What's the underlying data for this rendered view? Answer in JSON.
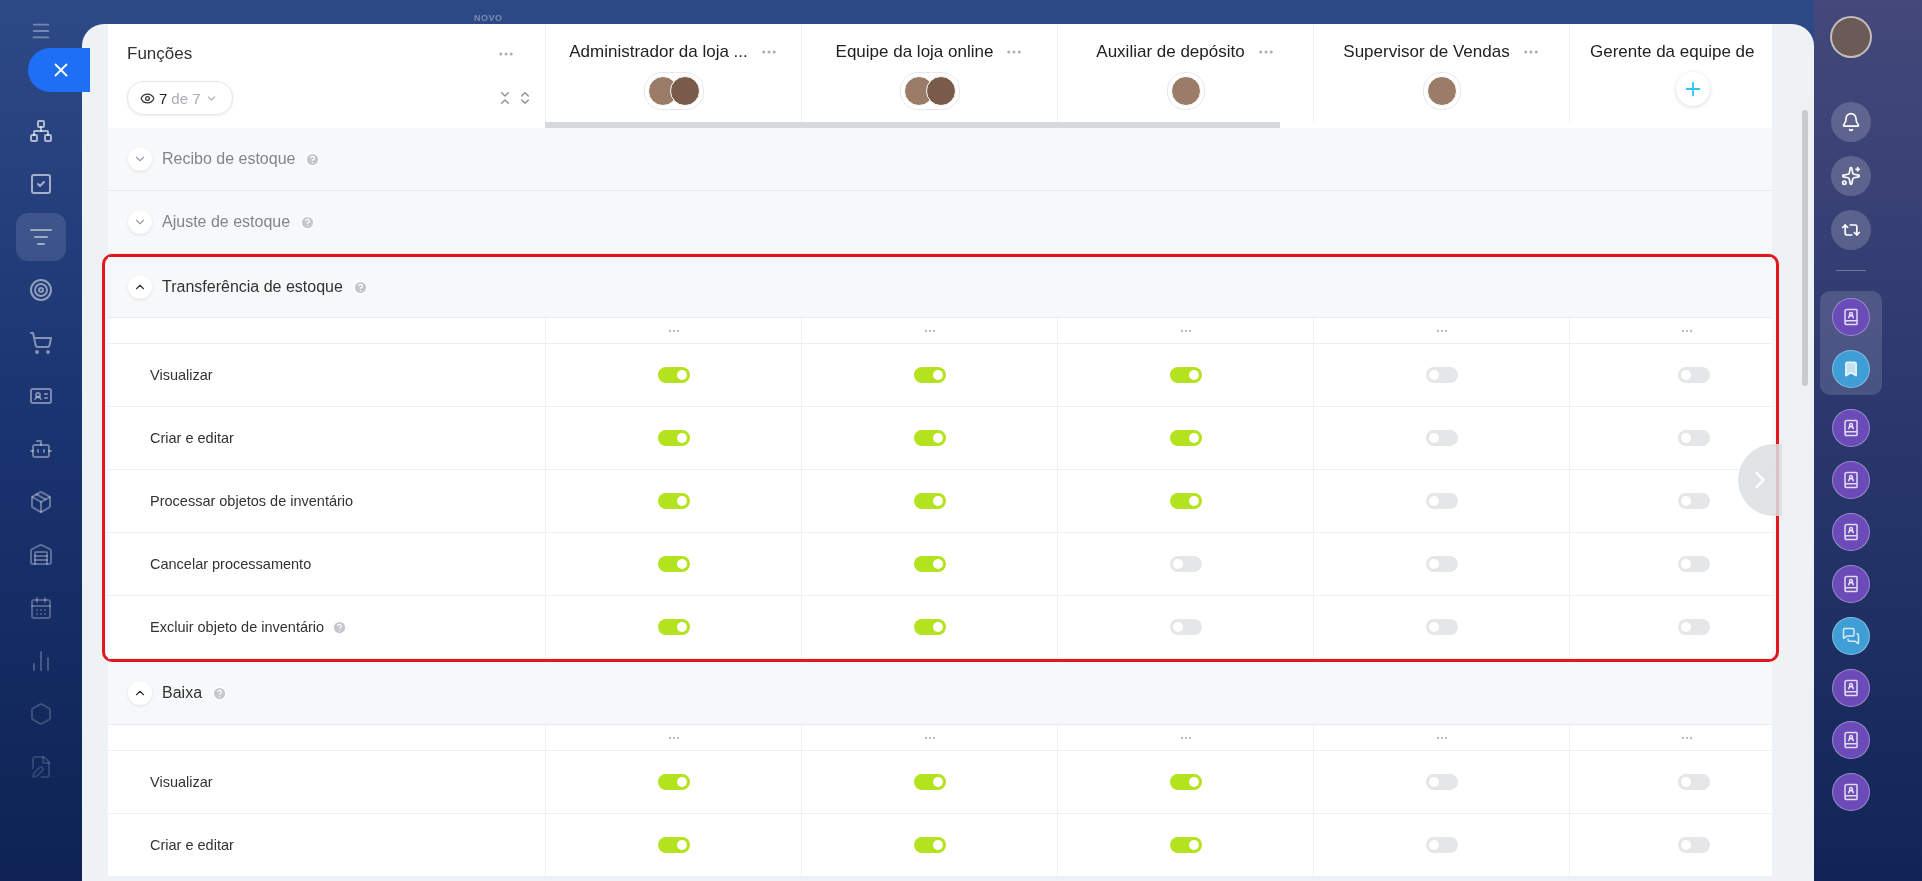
{
  "banner": {
    "label": "NOVO"
  },
  "header": {
    "title": "Funções",
    "filter": {
      "count": "7",
      "total": "de 7"
    }
  },
  "roles": [
    {
      "name": "Administrador da loja ...",
      "menu": true,
      "members": [
        {
          "kind": "photo"
        },
        {
          "kind": "photo"
        }
      ]
    },
    {
      "name": "Equipe da loja online",
      "menu": true,
      "members": [
        {
          "kind": "photo"
        },
        {
          "kind": "photo"
        }
      ]
    },
    {
      "name": "Auxiliar de depósito",
      "menu": true,
      "members": [
        {
          "kind": "photo"
        }
      ]
    },
    {
      "name": "Supervisor de Vendas",
      "menu": true,
      "members": [
        {
          "kind": "photo"
        }
      ]
    },
    {
      "name": "Gerente da equipe de",
      "menu": false,
      "members": [
        {
          "kind": "add"
        }
      ]
    }
  ],
  "sections": [
    {
      "title": "Recibo de estoque",
      "expanded": false,
      "help": true,
      "highlighted": false
    },
    {
      "title": "Ajuste de estoque",
      "expanded": false,
      "help": true,
      "highlighted": false
    },
    {
      "title": "Transferência de estoque",
      "expanded": true,
      "help": true,
      "highlighted": true,
      "rows": [
        {
          "label": "Visualizar",
          "help": false,
          "toggles": [
            {
              "on": true
            },
            {
              "on": true
            },
            {
              "on": true
            },
            {
              "on": false
            },
            {
              "on": false
            }
          ]
        },
        {
          "label": "Criar e editar",
          "help": false,
          "toggles": [
            {
              "on": true
            },
            {
              "on": true
            },
            {
              "on": true
            },
            {
              "on": false
            },
            {
              "on": false
            }
          ]
        },
        {
          "label": "Processar objetos de inventário",
          "help": false,
          "toggles": [
            {
              "on": true
            },
            {
              "on": true
            },
            {
              "on": true
            },
            {
              "on": false
            },
            {
              "on": false
            }
          ]
        },
        {
          "label": "Cancelar processamento",
          "help": false,
          "toggles": [
            {
              "on": true
            },
            {
              "on": true
            },
            {
              "on": false
            },
            {
              "on": false
            },
            {
              "on": false
            }
          ]
        },
        {
          "label": "Excluir objeto de inventário",
          "help": true,
          "toggles": [
            {
              "on": true
            },
            {
              "on": true
            },
            {
              "on": false
            },
            {
              "on": false
            },
            {
              "on": false
            }
          ]
        }
      ]
    },
    {
      "title": "Baixa",
      "expanded": true,
      "help": true,
      "highlighted": false,
      "rows": [
        {
          "label": "Visualizar",
          "help": false,
          "toggles": [
            {
              "on": true
            },
            {
              "on": true
            },
            {
              "on": true
            },
            {
              "on": false
            },
            {
              "on": false
            }
          ]
        },
        {
          "label": "Criar e editar",
          "help": false,
          "toggles": [
            {
              "on": true
            },
            {
              "on": true
            },
            {
              "on": true
            },
            {
              "on": false
            },
            {
              "on": false
            }
          ]
        }
      ]
    }
  ]
}
